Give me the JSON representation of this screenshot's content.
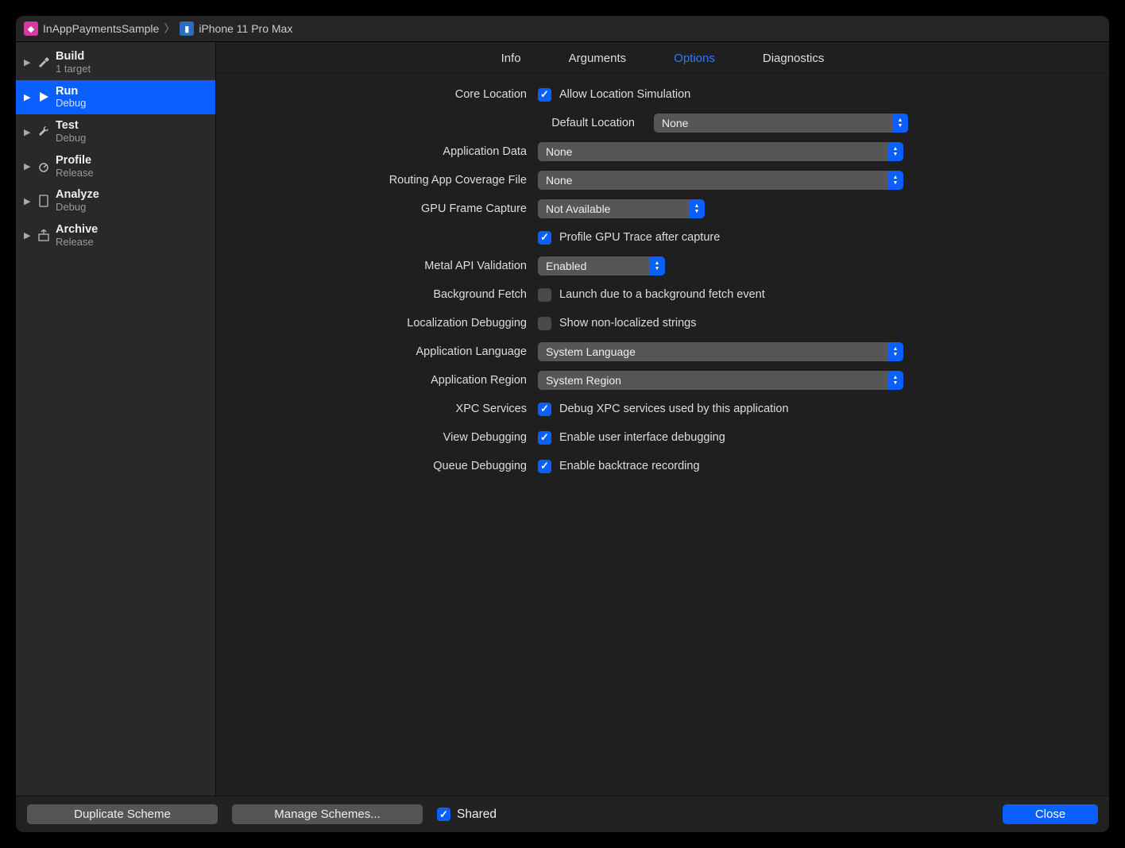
{
  "breadcrumb": {
    "scheme": "InAppPaymentsSample",
    "device": "iPhone 11 Pro Max"
  },
  "sidebar": [
    {
      "title": "Build",
      "sub": "1 target",
      "icon": "hammer"
    },
    {
      "title": "Run",
      "sub": "Debug",
      "icon": "play",
      "selected": true
    },
    {
      "title": "Test",
      "sub": "Debug",
      "icon": "wrench"
    },
    {
      "title": "Profile",
      "sub": "Release",
      "icon": "gauge"
    },
    {
      "title": "Analyze",
      "sub": "Debug",
      "icon": "doc"
    },
    {
      "title": "Archive",
      "sub": "Release",
      "icon": "box"
    }
  ],
  "tabs": [
    "Info",
    "Arguments",
    "Options",
    "Diagnostics"
  ],
  "active_tab": "Options",
  "form": {
    "core_location_label": "Core Location",
    "allow_loc_sim": "Allow Location Simulation",
    "default_location_label": "Default Location",
    "default_location_value": "None",
    "application_data_label": "Application Data",
    "application_data_value": "None",
    "routing_label": "Routing App Coverage File",
    "routing_value": "None",
    "gpu_label": "GPU Frame Capture",
    "gpu_value": "Not Available",
    "gpu_profile": "Profile GPU Trace after capture",
    "metal_label": "Metal API Validation",
    "metal_value": "Enabled",
    "bgfetch_label": "Background Fetch",
    "bgfetch_text": "Launch due to a background fetch event",
    "locdbg_label": "Localization Debugging",
    "locdbg_text": "Show non-localized strings",
    "applang_label": "Application Language",
    "applang_value": "System Language",
    "appregion_label": "Application Region",
    "appregion_value": "System Region",
    "xpc_label": "XPC Services",
    "xpc_text": "Debug XPC services used by this application",
    "viewdbg_label": "View Debugging",
    "viewdbg_text": "Enable user interface debugging",
    "qdbg_label": "Queue Debugging",
    "qdbg_text": "Enable backtrace recording"
  },
  "bottom": {
    "duplicate": "Duplicate Scheme",
    "manage": "Manage Schemes...",
    "shared": "Shared",
    "close": "Close"
  }
}
